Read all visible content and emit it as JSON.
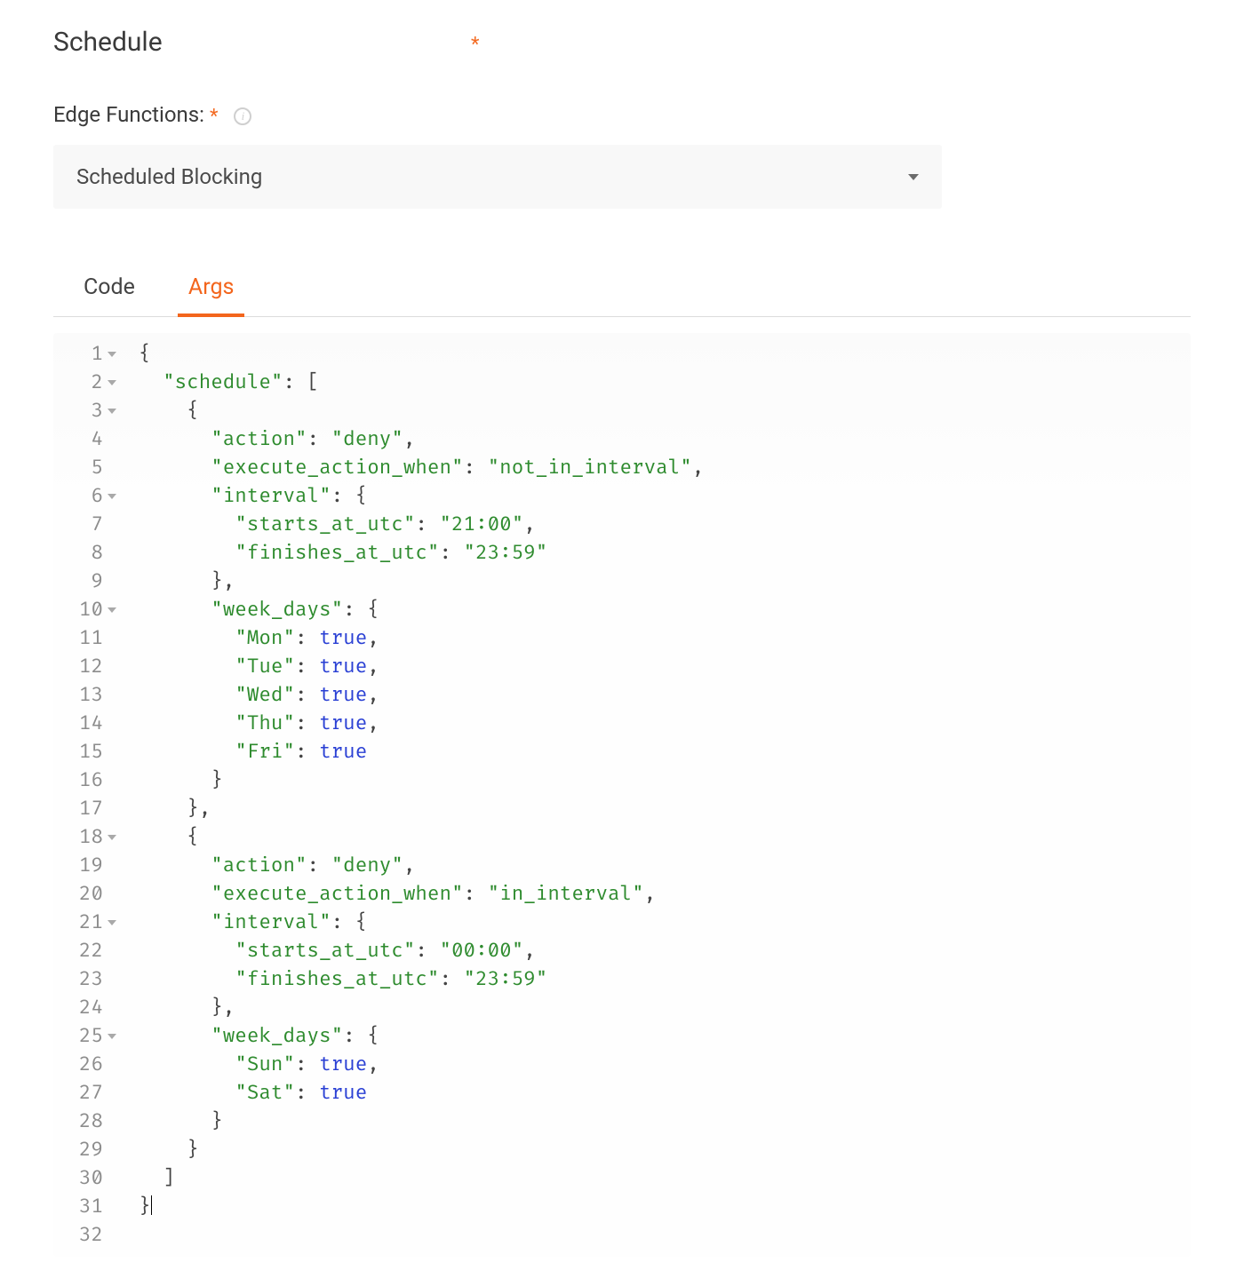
{
  "header": {
    "title": "Schedule",
    "required_mark": "*"
  },
  "edge_functions": {
    "label": "Edge Functions:",
    "required_mark": "*",
    "info_char": "i",
    "selected": "Scheduled Blocking"
  },
  "tabs": {
    "code": "Code",
    "args": "Args",
    "active": "args"
  },
  "gutter": [
    {
      "n": "1",
      "fold": true
    },
    {
      "n": "2",
      "fold": true
    },
    {
      "n": "3",
      "fold": true
    },
    {
      "n": "4",
      "fold": false
    },
    {
      "n": "5",
      "fold": false
    },
    {
      "n": "6",
      "fold": true
    },
    {
      "n": "7",
      "fold": false
    },
    {
      "n": "8",
      "fold": false
    },
    {
      "n": "9",
      "fold": false
    },
    {
      "n": "10",
      "fold": true
    },
    {
      "n": "11",
      "fold": false
    },
    {
      "n": "12",
      "fold": false
    },
    {
      "n": "13",
      "fold": false
    },
    {
      "n": "14",
      "fold": false
    },
    {
      "n": "15",
      "fold": false
    },
    {
      "n": "16",
      "fold": false
    },
    {
      "n": "17",
      "fold": false
    },
    {
      "n": "18",
      "fold": true
    },
    {
      "n": "19",
      "fold": false
    },
    {
      "n": "20",
      "fold": false
    },
    {
      "n": "21",
      "fold": true
    },
    {
      "n": "22",
      "fold": false
    },
    {
      "n": "23",
      "fold": false
    },
    {
      "n": "24",
      "fold": false
    },
    {
      "n": "25",
      "fold": true
    },
    {
      "n": "26",
      "fold": false
    },
    {
      "n": "27",
      "fold": false
    },
    {
      "n": "28",
      "fold": false
    },
    {
      "n": "29",
      "fold": false
    },
    {
      "n": "30",
      "fold": false
    },
    {
      "n": "31",
      "fold": false
    },
    {
      "n": "32",
      "fold": false
    }
  ],
  "code": [
    [
      {
        "t": "pun",
        "v": "{"
      }
    ],
    [
      {
        "t": "pun",
        "v": "  "
      },
      {
        "t": "key",
        "v": "\"schedule\""
      },
      {
        "t": "pun",
        "v": ": ["
      }
    ],
    [
      {
        "t": "pun",
        "v": "    {"
      }
    ],
    [
      {
        "t": "pun",
        "v": "      "
      },
      {
        "t": "key",
        "v": "\"action\""
      },
      {
        "t": "pun",
        "v": ": "
      },
      {
        "t": "str",
        "v": "\"deny\""
      },
      {
        "t": "pun",
        "v": ","
      }
    ],
    [
      {
        "t": "pun",
        "v": "      "
      },
      {
        "t": "key",
        "v": "\"execute_action_when\""
      },
      {
        "t": "pun",
        "v": ": "
      },
      {
        "t": "str",
        "v": "\"not_in_interval\""
      },
      {
        "t": "pun",
        "v": ","
      }
    ],
    [
      {
        "t": "pun",
        "v": "      "
      },
      {
        "t": "key",
        "v": "\"interval\""
      },
      {
        "t": "pun",
        "v": ": {"
      }
    ],
    [
      {
        "t": "pun",
        "v": "        "
      },
      {
        "t": "key",
        "v": "\"starts_at_utc\""
      },
      {
        "t": "pun",
        "v": ": "
      },
      {
        "t": "str",
        "v": "\"21:00\""
      },
      {
        "t": "pun",
        "v": ","
      }
    ],
    [
      {
        "t": "pun",
        "v": "        "
      },
      {
        "t": "key",
        "v": "\"finishes_at_utc\""
      },
      {
        "t": "pun",
        "v": ": "
      },
      {
        "t": "str",
        "v": "\"23:59\""
      }
    ],
    [
      {
        "t": "pun",
        "v": "      },"
      }
    ],
    [
      {
        "t": "pun",
        "v": "      "
      },
      {
        "t": "key",
        "v": "\"week_days\""
      },
      {
        "t": "pun",
        "v": ": {"
      }
    ],
    [
      {
        "t": "pun",
        "v": "        "
      },
      {
        "t": "key",
        "v": "\"Mon\""
      },
      {
        "t": "pun",
        "v": ": "
      },
      {
        "t": "bool",
        "v": "true"
      },
      {
        "t": "pun",
        "v": ","
      }
    ],
    [
      {
        "t": "pun",
        "v": "        "
      },
      {
        "t": "key",
        "v": "\"Tue\""
      },
      {
        "t": "pun",
        "v": ": "
      },
      {
        "t": "bool",
        "v": "true"
      },
      {
        "t": "pun",
        "v": ","
      }
    ],
    [
      {
        "t": "pun",
        "v": "        "
      },
      {
        "t": "key",
        "v": "\"Wed\""
      },
      {
        "t": "pun",
        "v": ": "
      },
      {
        "t": "bool",
        "v": "true"
      },
      {
        "t": "pun",
        "v": ","
      }
    ],
    [
      {
        "t": "pun",
        "v": "        "
      },
      {
        "t": "key",
        "v": "\"Thu\""
      },
      {
        "t": "pun",
        "v": ": "
      },
      {
        "t": "bool",
        "v": "true"
      },
      {
        "t": "pun",
        "v": ","
      }
    ],
    [
      {
        "t": "pun",
        "v": "        "
      },
      {
        "t": "key",
        "v": "\"Fri\""
      },
      {
        "t": "pun",
        "v": ": "
      },
      {
        "t": "bool",
        "v": "true"
      }
    ],
    [
      {
        "t": "pun",
        "v": "      }"
      }
    ],
    [
      {
        "t": "pun",
        "v": "    },"
      }
    ],
    [
      {
        "t": "pun",
        "v": "    {"
      }
    ],
    [
      {
        "t": "pun",
        "v": "      "
      },
      {
        "t": "key",
        "v": "\"action\""
      },
      {
        "t": "pun",
        "v": ": "
      },
      {
        "t": "str",
        "v": "\"deny\""
      },
      {
        "t": "pun",
        "v": ","
      }
    ],
    [
      {
        "t": "pun",
        "v": "      "
      },
      {
        "t": "key",
        "v": "\"execute_action_when\""
      },
      {
        "t": "pun",
        "v": ": "
      },
      {
        "t": "str",
        "v": "\"in_interval\""
      },
      {
        "t": "pun",
        "v": ","
      }
    ],
    [
      {
        "t": "pun",
        "v": "      "
      },
      {
        "t": "key",
        "v": "\"interval\""
      },
      {
        "t": "pun",
        "v": ": {"
      }
    ],
    [
      {
        "t": "pun",
        "v": "        "
      },
      {
        "t": "key",
        "v": "\"starts_at_utc\""
      },
      {
        "t": "pun",
        "v": ": "
      },
      {
        "t": "str",
        "v": "\"00:00\""
      },
      {
        "t": "pun",
        "v": ","
      }
    ],
    [
      {
        "t": "pun",
        "v": "        "
      },
      {
        "t": "key",
        "v": "\"finishes_at_utc\""
      },
      {
        "t": "pun",
        "v": ": "
      },
      {
        "t": "str",
        "v": "\"23:59\""
      }
    ],
    [
      {
        "t": "pun",
        "v": "      },"
      }
    ],
    [
      {
        "t": "pun",
        "v": "      "
      },
      {
        "t": "key",
        "v": "\"week_days\""
      },
      {
        "t": "pun",
        "v": ": {"
      }
    ],
    [
      {
        "t": "pun",
        "v": "        "
      },
      {
        "t": "key",
        "v": "\"Sun\""
      },
      {
        "t": "pun",
        "v": ": "
      },
      {
        "t": "bool",
        "v": "true"
      },
      {
        "t": "pun",
        "v": ","
      }
    ],
    [
      {
        "t": "pun",
        "v": "        "
      },
      {
        "t": "key",
        "v": "\"Sat\""
      },
      {
        "t": "pun",
        "v": ": "
      },
      {
        "t": "bool",
        "v": "true"
      }
    ],
    [
      {
        "t": "pun",
        "v": "      }"
      }
    ],
    [
      {
        "t": "pun",
        "v": "    }"
      }
    ],
    [
      {
        "t": "pun",
        "v": "  ]"
      }
    ],
    [
      {
        "t": "pun",
        "v": "}"
      },
      {
        "t": "cursor",
        "v": ""
      }
    ],
    []
  ]
}
